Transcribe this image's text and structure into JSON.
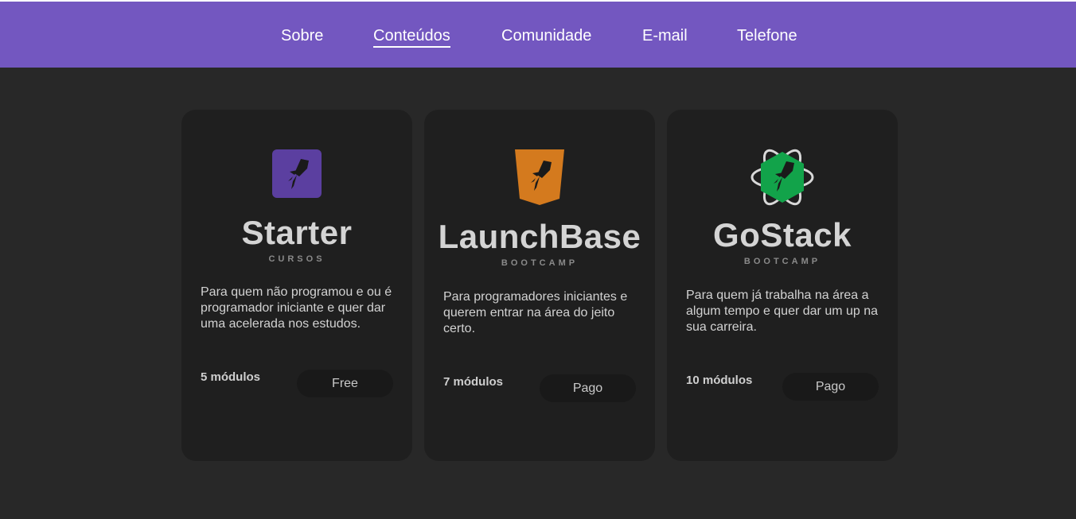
{
  "nav": {
    "items": [
      {
        "label": "Sobre"
      },
      {
        "label": "Conteúdos"
      },
      {
        "label": "Comunidade"
      },
      {
        "label": "E-mail"
      },
      {
        "label": "Telefone"
      }
    ],
    "active": "Conteúdos"
  },
  "cards": [
    {
      "title": "Starter",
      "subtitle": "CURSOS",
      "description": "Para quem não programou e ou é programador iniciante e quer dar uma acelerada nos estudos.",
      "modules": "5 módulos",
      "price": "Free",
      "accent": "#5b3fa0",
      "icon": "rocket-square-icon"
    },
    {
      "title": "LaunchBase",
      "subtitle": "BOOTCAMP",
      "description": "Para programadores iniciantes e querem entrar na área do jeito certo.",
      "modules": "7 módulos",
      "price": "Pago",
      "accent": "#d47a1e",
      "icon": "rocket-shield-icon"
    },
    {
      "title": "GoStack",
      "subtitle": "BOOTCAMP",
      "description": "Para quem já trabalha na área a algum tempo e quer dar um up na sua carreira.",
      "modules": "10 módulos",
      "price": "Pago",
      "accent": "#12a34a",
      "icon": "rocket-atom-icon"
    }
  ]
}
